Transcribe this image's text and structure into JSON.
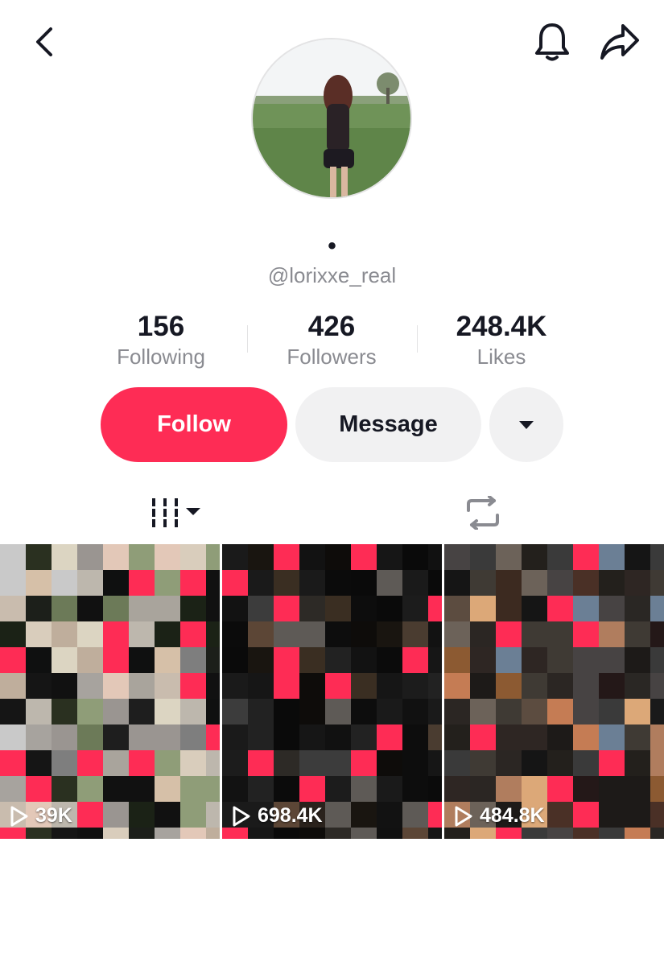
{
  "header": {
    "back_icon": "chevron-left-icon",
    "bell_icon": "bell-icon",
    "share_icon": "share-arrow-icon"
  },
  "profile": {
    "nickname": "•",
    "username": "@lorixxe_real"
  },
  "stats": {
    "following": {
      "value": "156",
      "label": "Following"
    },
    "followers": {
      "value": "426",
      "label": "Followers"
    },
    "likes": {
      "value": "248.4K",
      "label": "Likes"
    }
  },
  "actions": {
    "follow_label": "Follow",
    "message_label": "Message",
    "more_icon": "caret-down-icon"
  },
  "tabs": [
    {
      "name": "videos",
      "icon": "grid-lines-icon"
    },
    {
      "name": "reposts",
      "icon": "repost-icon"
    }
  ],
  "videos": [
    {
      "views": "39K"
    },
    {
      "views": "698.4K"
    },
    {
      "views": "484.8K"
    }
  ],
  "colors": {
    "accent": "#fe2c55",
    "secondary_text": "#8a8b91",
    "button_gray": "#f1f1f2"
  }
}
